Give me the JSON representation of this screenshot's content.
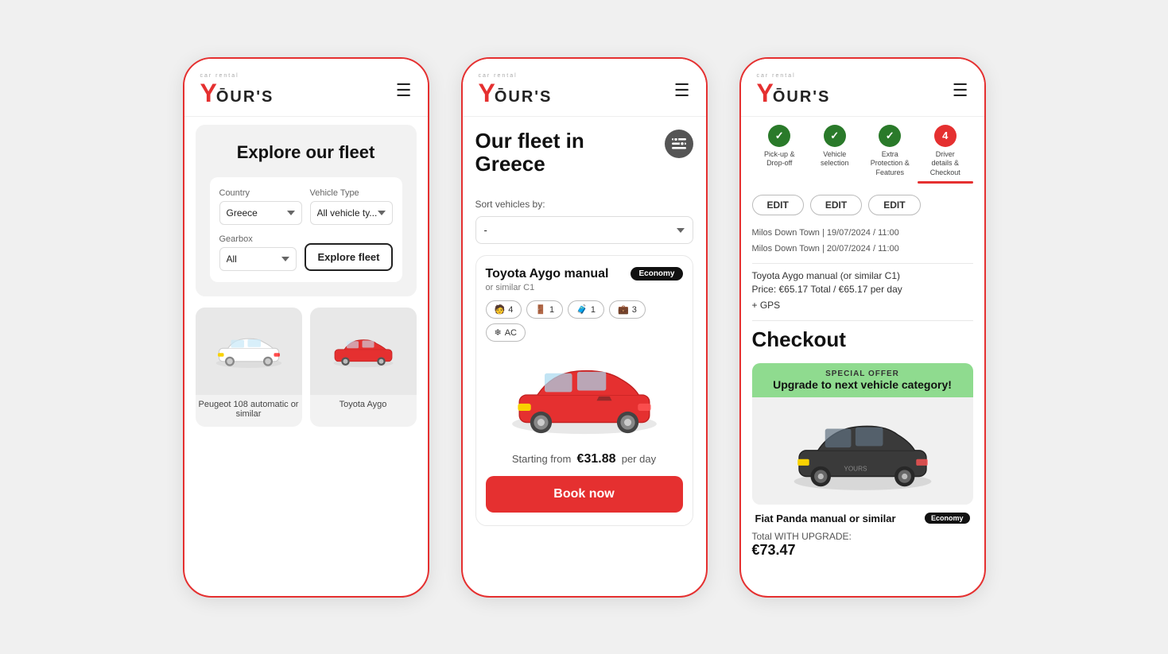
{
  "brand": {
    "name": "YOURS",
    "tagline": "car rental",
    "logo_y": "Y"
  },
  "screen1": {
    "title": "Explore our fleet",
    "filter": {
      "country_label": "Country",
      "country_value": "Greece",
      "vehicle_type_label": "Vehicle Type",
      "vehicle_type_value": "All vehicle ty...",
      "gearbox_label": "Gearbox",
      "gearbox_value": "All",
      "explore_btn": "Explore fleet"
    },
    "cars": [
      {
        "label": "Peugeot 108 automatic or similar"
      },
      {
        "label": "Toyota Aygo"
      }
    ]
  },
  "screen2": {
    "title": "Our fleet in\nGreece",
    "sort_label": "Sort vehicles by:",
    "sort_value": "-",
    "vehicle": {
      "name": "Toyota Aygo manual",
      "similar": "or similar C1",
      "badge": "Economy",
      "features": [
        {
          "icon": "👤",
          "value": "4"
        },
        {
          "icon": "🚪",
          "value": "1"
        },
        {
          "icon": "🧳",
          "value": "1"
        },
        {
          "icon": "💼",
          "value": "3"
        },
        {
          "icon": "❄",
          "extra": "AC"
        }
      ],
      "price_from": "Starting from",
      "price": "€31.88",
      "price_unit": "per day",
      "book_btn": "Book now"
    }
  },
  "screen3": {
    "steps": [
      {
        "number": "1",
        "label": "Pick-up &\nDrop-off",
        "state": "done"
      },
      {
        "number": "2",
        "label": "Vehicle\nselection",
        "state": "done"
      },
      {
        "number": "3",
        "label": "Extra\nProtection &\nFeatures",
        "state": "done"
      },
      {
        "number": "4",
        "label": "Driver\ndetails &\nCheckout",
        "state": "active"
      }
    ],
    "edit_buttons": [
      "EDIT",
      "EDIT",
      "EDIT"
    ],
    "booking": {
      "pickup": "Milos Down Town | 19/07/2024 / 11:00",
      "dropoff": "Milos Down Town | 20/07/2024 / 11:00",
      "car": "Toyota Aygo manual (or similar C1)",
      "price_total": "Price: €65.17 Total / €65.17 per day",
      "extras": "+ GPS"
    },
    "checkout_title": "Checkout",
    "special_offer": {
      "tag": "SPECIAL OFFER",
      "message": "Upgrade to next vehicle category!",
      "car_name": "Fiat Panda manual or similar",
      "badge": "Economy",
      "total_label": "Total WITH UPGRADE:",
      "total_price": "€73.47"
    }
  }
}
